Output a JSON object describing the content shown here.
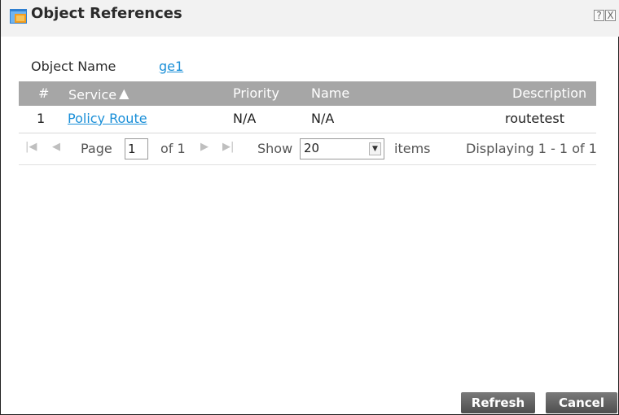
{
  "dialog": {
    "title": "Object References",
    "help_icon": "?",
    "close_icon": "X",
    "icon": "object-references-icon"
  },
  "object": {
    "label": "Object Name",
    "value": "ge1"
  },
  "grid": {
    "columns": [
      "#",
      "Service",
      "Priority",
      "Name",
      "Description"
    ],
    "sort_column": "Service",
    "sort_direction": "ascending",
    "rows": [
      {
        "index": "1",
        "service": "Policy Route",
        "priority": "N/A",
        "name": "N/A",
        "description": "routetest"
      }
    ]
  },
  "pager": {
    "page_label": "Page",
    "page_value": "1",
    "of_label": "of 1",
    "show_label": "Show",
    "show_value": "20",
    "items_label": "items",
    "display_text": "Displaying 1 - 1 of 1"
  },
  "buttons": {
    "refresh": "Refresh",
    "cancel": "Cancel"
  },
  "colors": {
    "header_bg": "#a6a6a6",
    "link": "#1a8fd8",
    "button_bg": "#5a5a5a"
  }
}
